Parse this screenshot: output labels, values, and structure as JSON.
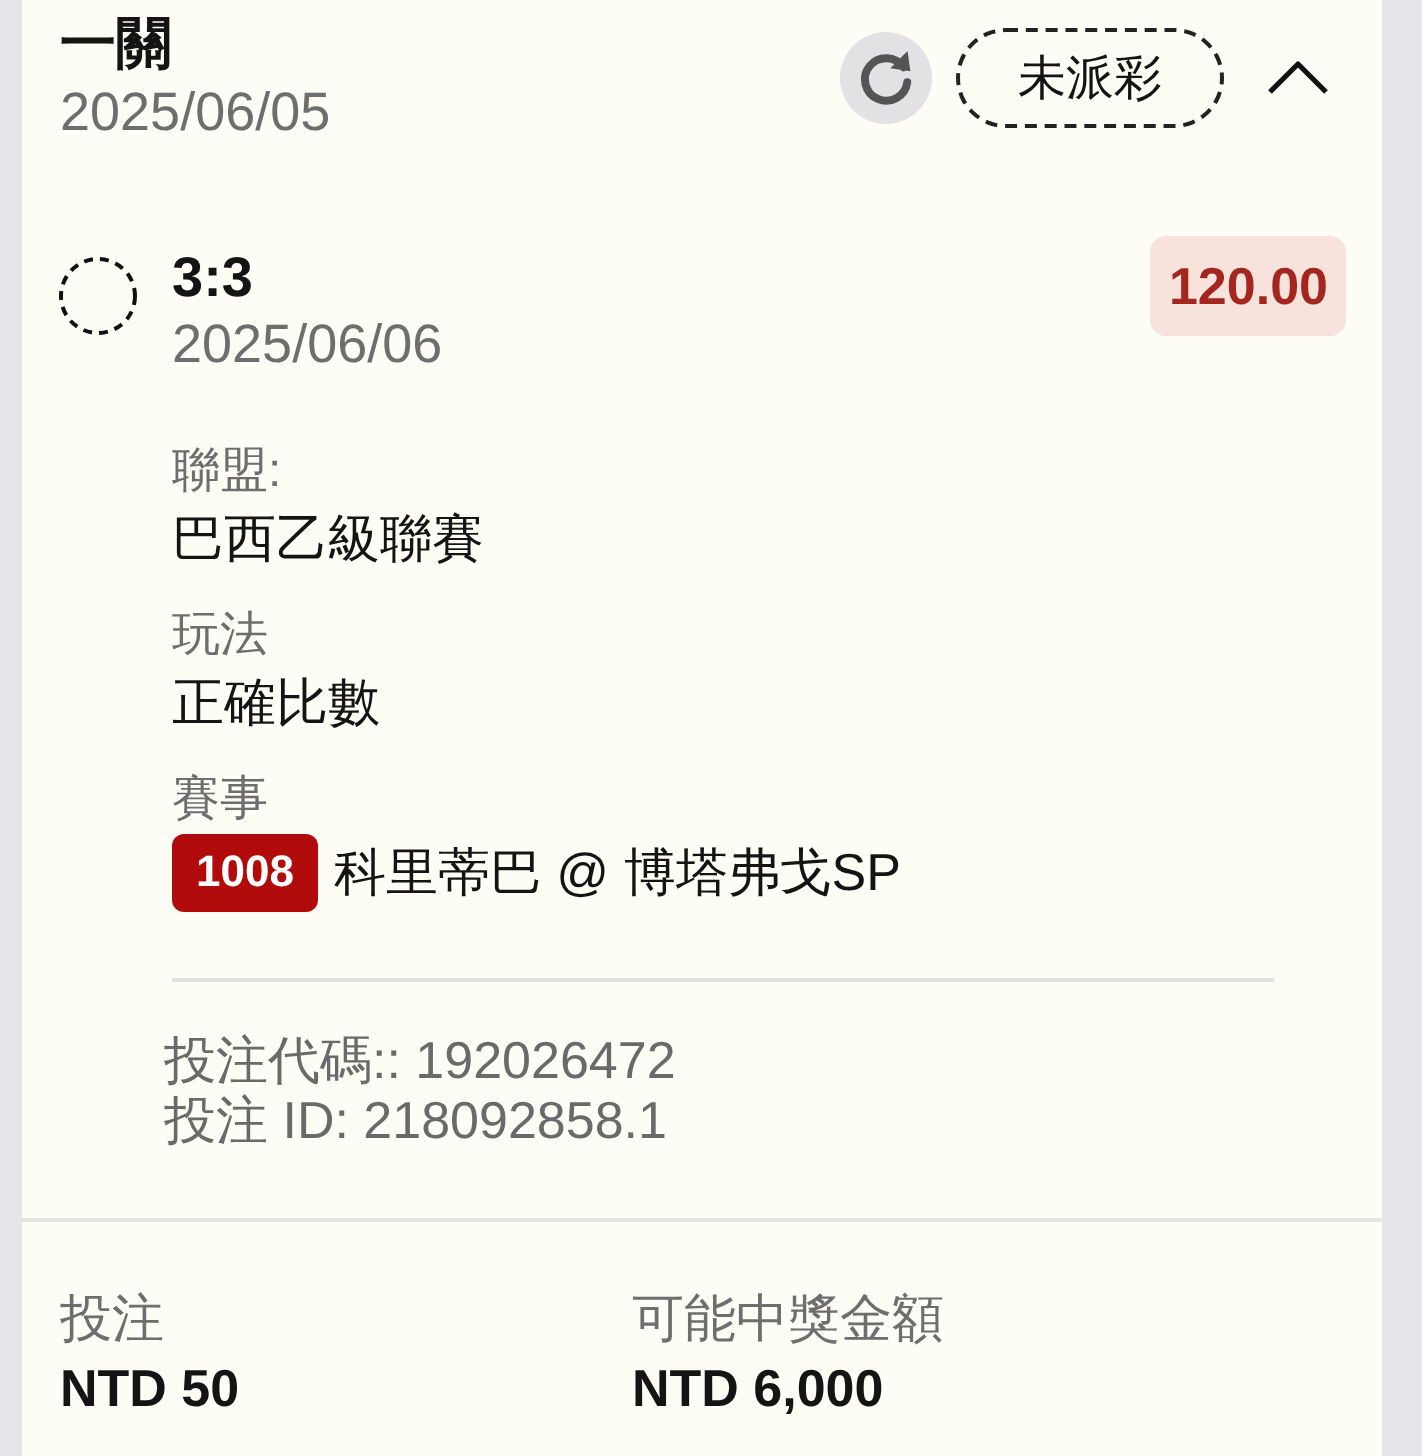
{
  "bet": {
    "type": "一關",
    "date": "2025/06/05",
    "status": "未派彩",
    "expanded": true
  },
  "selection": {
    "pick": "3:3",
    "date": "2025/06/06",
    "odds": "120.00",
    "details": [
      {
        "label": "聯盟:",
        "value": "巴西乙級聯賽"
      },
      {
        "label": "玩法",
        "value": "正確比數"
      }
    ],
    "event": {
      "label": "賽事",
      "code": "1008",
      "match": "科里蒂巴 @ 博塔弗戈SP"
    },
    "references": [
      "投注代碼:: 192026472",
      "投注 ID: 218092858.1"
    ]
  },
  "summary": [
    {
      "label": "投注",
      "value": "NTD 50"
    },
    {
      "label": "可能中獎金額",
      "value": "NTD 6,000"
    }
  ]
}
